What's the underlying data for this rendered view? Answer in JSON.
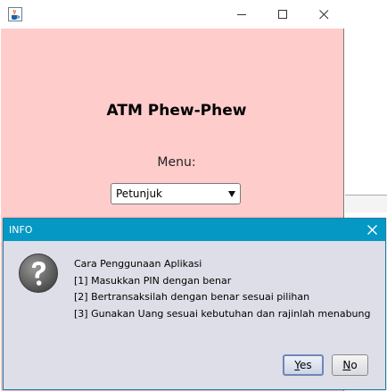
{
  "main_window": {
    "title": "",
    "icon": "java-cup-icon",
    "controls": {
      "minimize": "minimize-icon",
      "maximize": "maximize-icon",
      "close": "close-icon"
    },
    "app_title": "ATM Phew-Phew",
    "menu_label": "Menu:",
    "menu_select": {
      "value": "Petunjuk"
    },
    "background_color": "#ffcccc"
  },
  "dialog": {
    "title": "INFO",
    "icon": "question-icon",
    "message_lines": [
      "Cara Penggunaan Aplikasi",
      "[1] Masukkan PIN dengan benar",
      "[2] Bertransaksilah dengan benar sesuai pilihan",
      "[3] Gunakan Uang sesuai kebutuhan dan rajinlah menabung"
    ],
    "buttons": {
      "yes": {
        "mnemonic": "Y",
        "rest": "es"
      },
      "no": {
        "mnemonic": "N",
        "rest": "o"
      }
    },
    "titlebar_color": "#0698c4"
  }
}
